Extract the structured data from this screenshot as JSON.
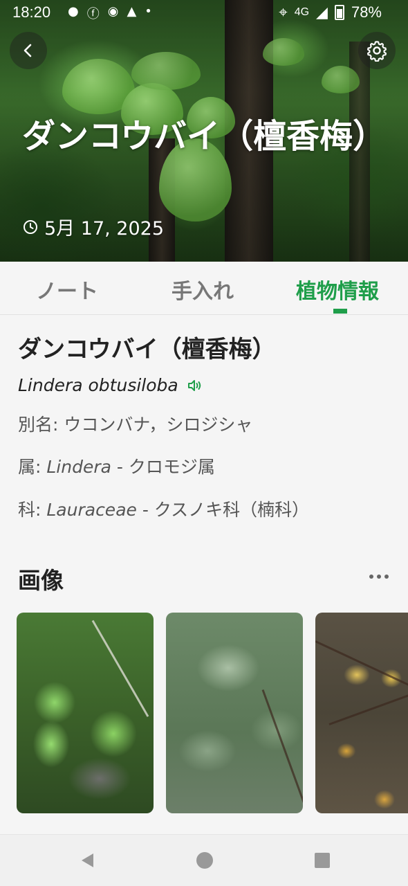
{
  "status_bar": {
    "time": "18:20",
    "network": "4G",
    "battery": "78%"
  },
  "hero": {
    "title": "ダンコウバイ（檀香梅）",
    "date": "5月 17, 2025",
    "back_icon": "chevron-left-icon",
    "settings_icon": "gear-icon",
    "date_icon": "clock-icon"
  },
  "tabs": [
    {
      "label": "ノート",
      "active": false
    },
    {
      "label": "手入れ",
      "active": false
    },
    {
      "label": "植物情報",
      "active": true
    }
  ],
  "plant": {
    "name": "ダンコウバイ（檀香梅）",
    "scientific_name": "Lindera obtusiloba",
    "alias_label": "別名: ",
    "alias_value": "ウコンバナ，シロジシャ",
    "genus_label": "属: ",
    "genus_latin": "Lindera",
    "genus_rest": " - クロモジ属",
    "family_label": "科: ",
    "family_latin": "Lauraceae",
    "family_rest": " - クスノキ科（楠科）"
  },
  "images_section": {
    "title": "画像",
    "photos": [
      "plant-photo-1",
      "plant-photo-2",
      "plant-photo-3"
    ]
  },
  "colors": {
    "accent": "#1f9e4a",
    "background": "#f5f5f5"
  }
}
